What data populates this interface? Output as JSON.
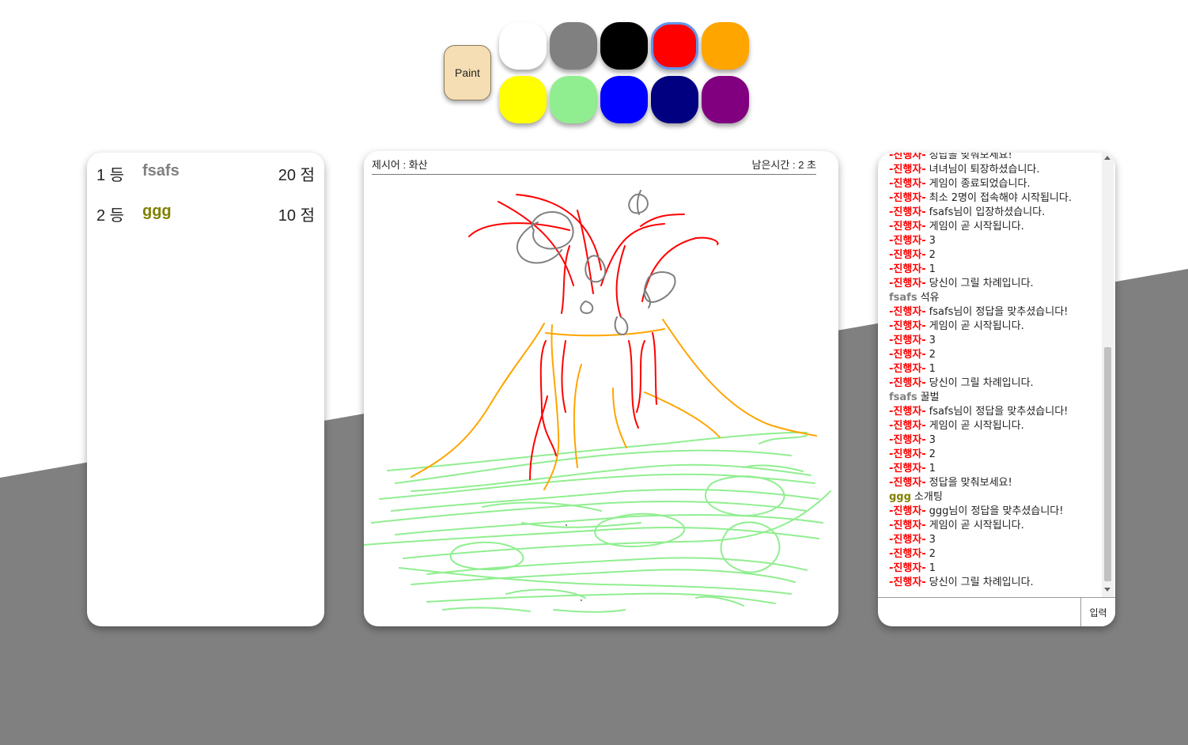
{
  "palette": {
    "paint_label": "Paint",
    "colors": [
      "#ffffff",
      "#808080",
      "#000000",
      "#ff0000",
      "#ffa500",
      "#ffff00",
      "#90ee90",
      "#0000ff",
      "#000080",
      "#800080"
    ],
    "selected_color": "#ff0000"
  },
  "ranking": [
    {
      "position": "1 등",
      "name": "fsafs",
      "name_color": "#808080",
      "score": "20 점"
    },
    {
      "position": "2 등",
      "name": "ggg",
      "name_color": "#808000",
      "score": "10 점"
    }
  ],
  "canvas": {
    "word_label": "제시어 : 화산",
    "time_label": "남은시간 : 2 초"
  },
  "chat": {
    "system_color": "#ff0000",
    "messages": [
      {
        "sender": "-진행자-",
        "text": "정답을 맞춰보세요!",
        "system": true
      },
      {
        "sender": "-진행자-",
        "text": "녀녀님이 퇴장하셨습니다.",
        "system": true
      },
      {
        "sender": "-진행자-",
        "text": "게임이 종료되었습니다.",
        "system": true
      },
      {
        "sender": "-진행자-",
        "text": "최소 2명이 접속해야 시작됩니다.",
        "system": true,
        "wrapped": true
      },
      {
        "sender": "-진행자-",
        "text": "fsafs님이 입장하셨습니다.",
        "system": true
      },
      {
        "sender": "-진행자-",
        "text": "게임이 곧 시작됩니다.",
        "system": true
      },
      {
        "sender": "-진행자-",
        "text": "3",
        "system": true
      },
      {
        "sender": "-진행자-",
        "text": "2",
        "system": true
      },
      {
        "sender": "-진행자-",
        "text": "1",
        "system": true
      },
      {
        "sender": "-진행자-",
        "text": "당신이 그릴 차례입니다.",
        "system": true
      },
      {
        "sender": "fsafs",
        "text": "석유",
        "system": false,
        "color": "#808080"
      },
      {
        "sender": "-진행자-",
        "text": "fsafs님이 정답을 맞추셨습니다!",
        "system": true
      },
      {
        "sender": "-진행자-",
        "text": "게임이 곧 시작됩니다.",
        "system": true
      },
      {
        "sender": "-진행자-",
        "text": "3",
        "system": true
      },
      {
        "sender": "-진행자-",
        "text": "2",
        "system": true
      },
      {
        "sender": "-진행자-",
        "text": "1",
        "system": true
      },
      {
        "sender": "-진행자-",
        "text": "당신이 그릴 차례입니다.",
        "system": true
      },
      {
        "sender": "fsafs",
        "text": "꿀벌",
        "system": false,
        "color": "#808080"
      },
      {
        "sender": "-진행자-",
        "text": "fsafs님이 정답을 맞추셨습니다!",
        "system": true
      },
      {
        "sender": "-진행자-",
        "text": "게임이 곧 시작됩니다.",
        "system": true
      },
      {
        "sender": "-진행자-",
        "text": "3",
        "system": true
      },
      {
        "sender": "-진행자-",
        "text": "2",
        "system": true
      },
      {
        "sender": "-진행자-",
        "text": "1",
        "system": true
      },
      {
        "sender": "-진행자-",
        "text": "정답을 맞춰보세요!",
        "system": true
      },
      {
        "sender": "ggg",
        "text": "소개팅",
        "system": false,
        "color": "#808000"
      },
      {
        "sender": "-진행자-",
        "text": "ggg님이 정답을 맞추셨습니다!",
        "system": true
      },
      {
        "sender": "-진행자-",
        "text": "게임이 곧 시작됩니다.",
        "system": true
      },
      {
        "sender": "-진행자-",
        "text": "3",
        "system": true
      },
      {
        "sender": "-진행자-",
        "text": "2",
        "system": true
      },
      {
        "sender": "-진행자-",
        "text": "1",
        "system": true
      },
      {
        "sender": "-진행자-",
        "text": "당신이 그릴 차례입니다.",
        "system": true
      }
    ],
    "input_value": "",
    "send_label": "입력"
  }
}
